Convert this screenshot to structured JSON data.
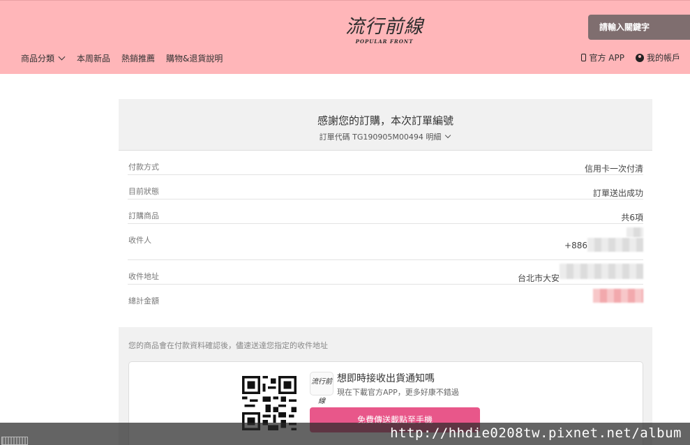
{
  "header": {
    "logo_main": "流行前線",
    "logo_sub": "POPULAR FRONT",
    "search_placeholder": "請輸入關鍵字",
    "nav": [
      "商品分類",
      "本周新品",
      "熱銷推薦",
      "購物&退貨說明"
    ],
    "app_link": "官方 APP",
    "account_link": "我的帳戶"
  },
  "order": {
    "title": "感謝您的訂購，本次訂單編號",
    "code_line": "訂單代碼 TG190905M00494 明細",
    "rows": [
      {
        "label": "付款方式",
        "value": "信用卡一次付清"
      },
      {
        "label": "目前狀態",
        "value": "訂單送出成功"
      },
      {
        "label": "訂購商品",
        "value": "共6項"
      },
      {
        "label": "收件人",
        "value": "+886"
      },
      {
        "label": "收件地址",
        "value": "台北市大安"
      },
      {
        "label": "總計金額",
        "value": ""
      }
    ]
  },
  "notice": {
    "text": "您的商品會在付款資料確認後，儘速送達您指定的收件地址",
    "app_icon_text": "流行前線",
    "app_title": "想即時接收出貨通知嗎",
    "app_desc": "現在下載官方APP，更多好康不錯過",
    "app_button": "免費傳送載點至手機"
  },
  "watermark": {
    "url": "http://hhdie0208tw.pixnet.net/album"
  },
  "colors": {
    "header_bg": "#ffb6b9",
    "search_bg": "#7f6e6f",
    "cta_button": "#e8578a"
  }
}
